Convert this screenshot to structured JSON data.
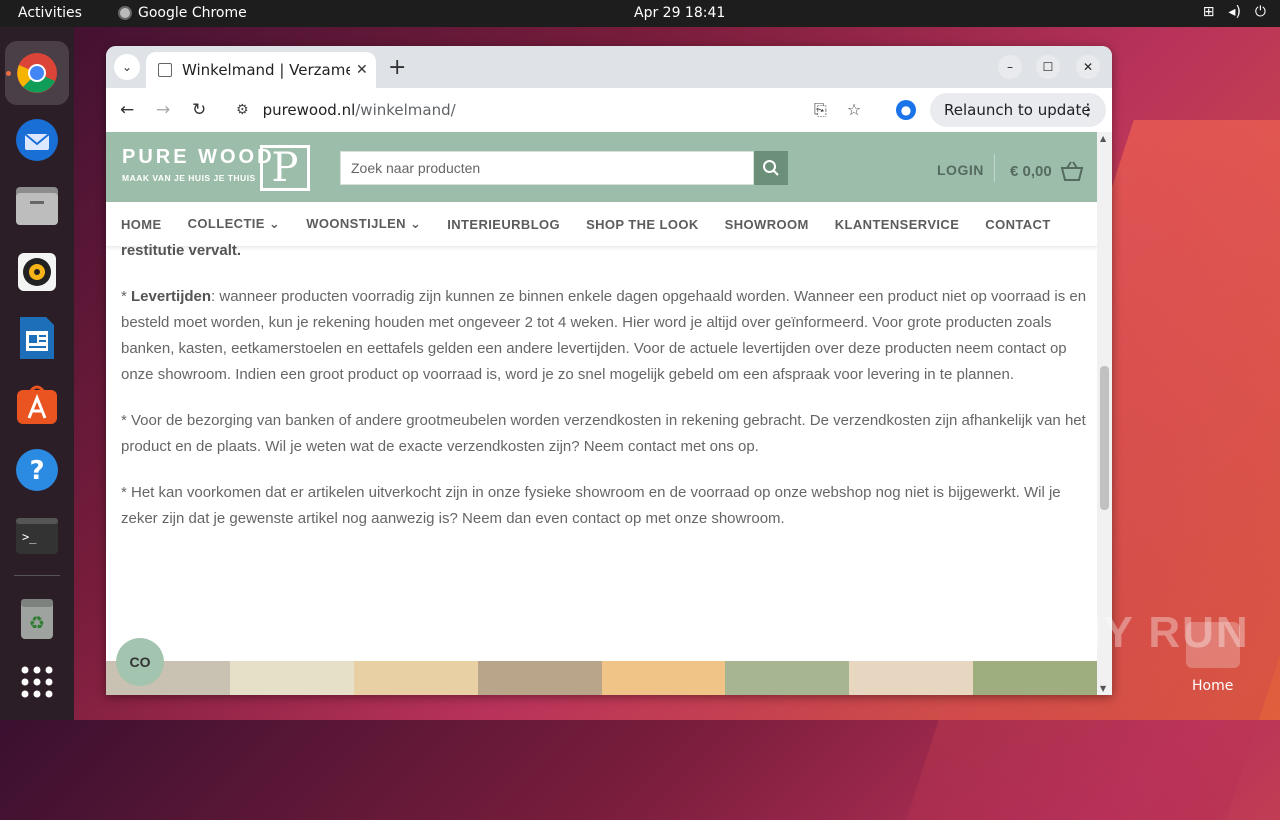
{
  "topbar": {
    "activities": "Activities",
    "app_name": "Google Chrome",
    "clock": "Apr 29  18:41",
    "tray_icons": [
      "network-icon",
      "volume-icon",
      "power-icon"
    ]
  },
  "dock": {
    "items": [
      "chrome",
      "thunderbird",
      "files",
      "rhythmbox",
      "libreoffice-writer",
      "app-center",
      "help",
      "terminal",
      "trash",
      "app-grid"
    ]
  },
  "browser": {
    "tab_title": "Winkelmand | Verzamel je",
    "new_tab": "+",
    "url_host": "purewood.nl",
    "url_path": "/winkelmand/",
    "relaunch": "Relaunch to update",
    "profile_initial": "●"
  },
  "site": {
    "logo_line1": "PURE WOOD",
    "logo_line2": "MAAK VAN JE HUIS JE THUIS",
    "logo_mark": "P",
    "search_placeholder": "Zoek naar producten",
    "login": "LOGIN",
    "cart": "€ 0,00",
    "menu": [
      "HOME",
      "COLLECTIE",
      "WOONSTIJLEN",
      "INTERIEURBLOG",
      "SHOP THE LOOK",
      "SHOWROOM",
      "KLANTENSERVICE",
      "CONTACT"
    ],
    "accent_color": "#9cbda9"
  },
  "content": {
    "p0": "restitutie vervalt.",
    "p1_bold": "Levertijden",
    "p1_prefix": "* ",
    "p1_text": ": wanneer producten voorradig zijn kunnen ze binnen enkele dagen opgehaald worden. Wanneer een product niet op voorraad is en besteld moet worden, kun je rekening houden met ongeveer 2 tot 4 weken. Hier word je altijd over geïnformeerd. Voor grote producten zoals banken, kasten, eetkamerstoelen en eettafels gelden een andere levertijden. Voor de actuele levertijden over deze producten neem contact op onze showroom. Indien een groot product op voorraad is, word je zo snel mogelijk gebeld om een afspraak voor levering in te plannen.",
    "p2": "* Voor de bezorging van banken of andere grootmeubelen worden verzendkosten in rekening gebracht. De verzendkosten zijn afhankelijk van het product en de plaats. Wil je weten wat de exacte verzendkosten zijn? Neem contact met ons op.",
    "p3": "* Het kan voorkomen dat er artikelen uitverkocht zijn in onze fysieke showroom en de voorraad op onze webshop nog niet is bijgewerkt. Wil je zeker zijn dat je gewenste artikel nog aanwezig is? Neem dan even contact op met onze showroom."
  },
  "chat_icon": "CO",
  "desktop": {
    "watermark": "ANY RUN",
    "home_label": "Home"
  }
}
